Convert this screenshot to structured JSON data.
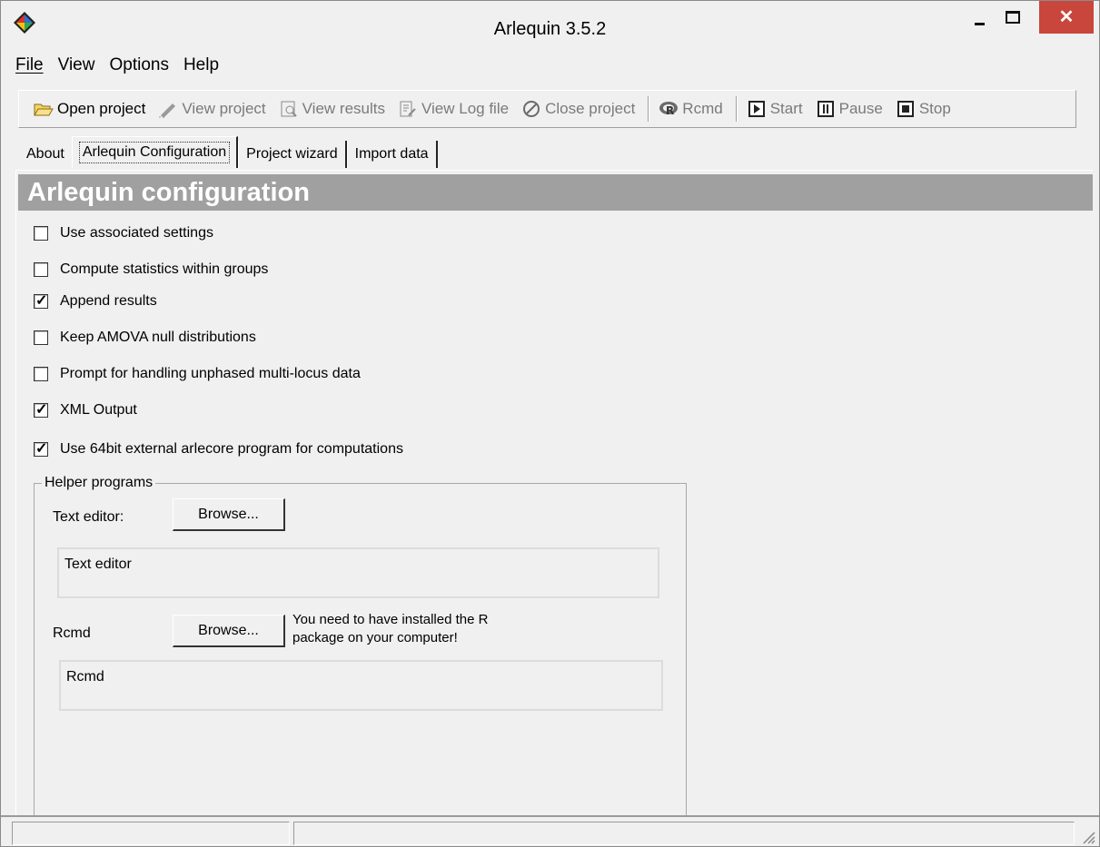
{
  "window": {
    "title": "Arlequin 3.5.2",
    "colors": {
      "close_button": "#c9463d",
      "header_band": "#a0a0a0",
      "background": "#f0f0f0"
    }
  },
  "menu": [
    "File",
    "View",
    "Options",
    "Help"
  ],
  "toolbar": {
    "open_project": "Open project",
    "view_project": "View project",
    "view_results": "View results",
    "view_log_file": "View Log file",
    "close_project": "Close project",
    "rcmd": "Rcmd",
    "start": "Start",
    "pause": "Pause",
    "stop": "Stop"
  },
  "tabs": [
    "About",
    "Arlequin Configuration",
    "Project wizard",
    "Import data"
  ],
  "config": {
    "heading": "Arlequin configuration",
    "options": [
      {
        "label": "Use associated settings",
        "checked": false
      },
      {
        "label": "Compute statistics within groups",
        "checked": false
      },
      {
        "label": "Append results",
        "checked": true
      },
      {
        "label": "Keep AMOVA null distributions",
        "checked": false
      },
      {
        "label": "Prompt for handling unphased multi-locus data",
        "checked": false
      },
      {
        "label": "XML Output",
        "checked": true
      },
      {
        "label": "Use 64bit external arlecore program for computations",
        "checked": true
      }
    ]
  },
  "helper": {
    "legend": "Helper programs",
    "text_editor_label": "Text editor:",
    "text_editor_browse": "Browse...",
    "text_editor_value": "Text editor",
    "rcmd_label": "Rcmd",
    "rcmd_browse": "Browse...",
    "rcmd_note_line1": "You need to have installed the R",
    "rcmd_note_line2": "package on your computer!",
    "rcmd_value": "Rcmd"
  }
}
